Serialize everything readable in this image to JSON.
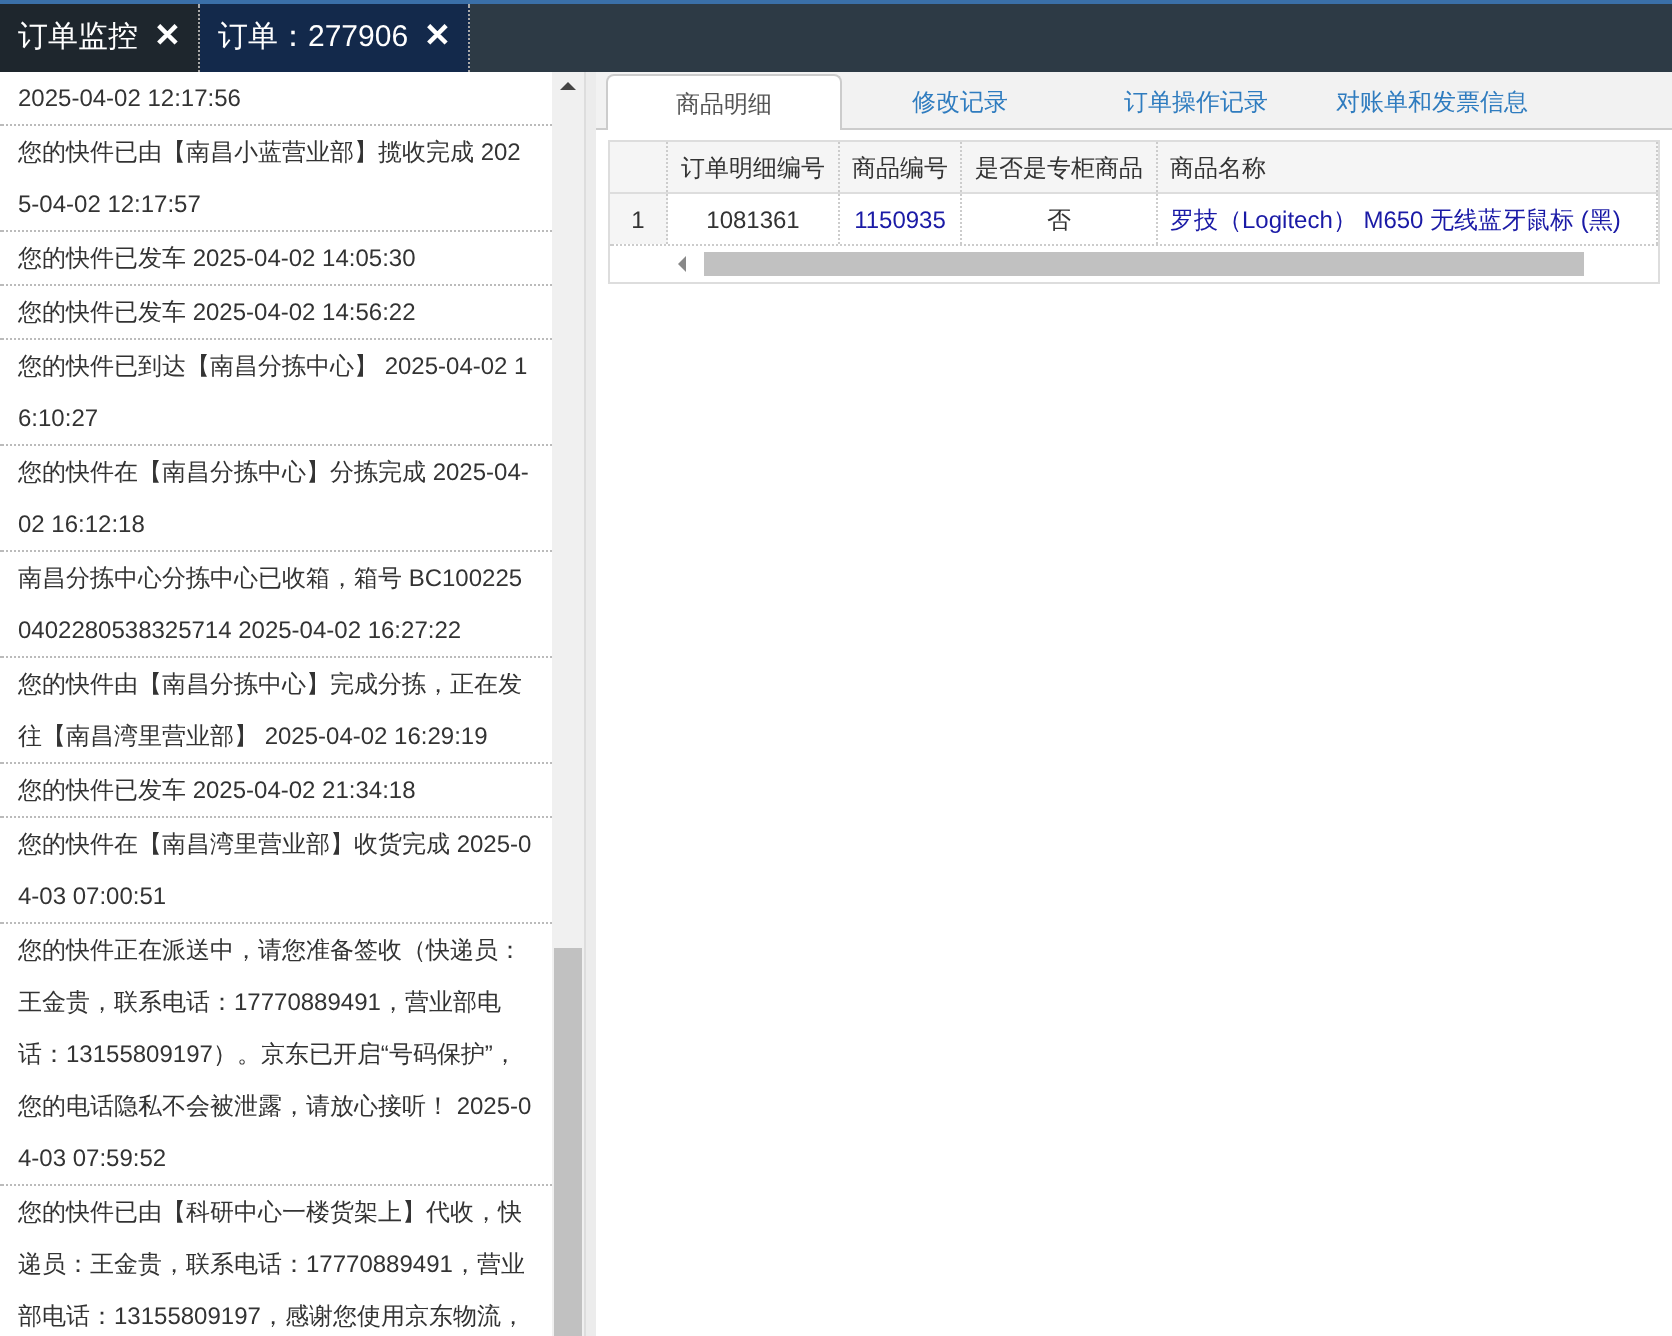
{
  "top_tabs": [
    {
      "label": "订单监控",
      "close": "✕",
      "selected": false
    },
    {
      "label": "订单：277906",
      "close": "✕",
      "selected": true
    }
  ],
  "tracking_log": [
    {
      "text": "2025-04-02 12:17:56"
    },
    {
      "text": "您的快件已由【南昌小蓝营业部】揽收完成 2025-04-02 12:17:57"
    },
    {
      "text": "您的快件已发车 2025-04-02 14:05:30"
    },
    {
      "text": "您的快件已发车 2025-04-02 14:56:22"
    },
    {
      "text": "您的快件已到达【南昌分拣中心】 2025-04-02 16:10:27"
    },
    {
      "text": "您的快件在【南昌分拣中心】分拣完成 2025-04-02 16:12:18"
    },
    {
      "text": "南昌分拣中心分拣中心已收箱，箱号 BC1002250402280538325714 2025-04-02 16:27:22"
    },
    {
      "text": "您的快件由【南昌分拣中心】完成分拣，正在发往【南昌湾里营业部】 2025-04-02 16:29:19"
    },
    {
      "text": "您的快件已发车 2025-04-02 21:34:18"
    },
    {
      "text": "您的快件在【南昌湾里营业部】收货完成 2025-04-03 07:00:51"
    },
    {
      "text": "您的快件正在派送中，请您准备签收（快递员：王金贵，联系电话：17770889491，营业部电话：13155809197）。京东已开启“号码保护”，您的电话隐私不会被泄露，请放心接听！ 2025-04-03 07:59:52"
    },
    {
      "text": "您的快件已由【科研中心一楼货架上】代收，快递员：王金贵，联系电话：17770889491，营业部电话：13155809197，感谢您使用京东物流，"
    }
  ],
  "detail_tabs": [
    {
      "label": "商品明细",
      "selected": true
    },
    {
      "label": "修改记录",
      "selected": false
    },
    {
      "label": "订单操作记录",
      "selected": false
    },
    {
      "label": "对账单和发票信息",
      "selected": false
    }
  ],
  "table": {
    "columns": [
      "订单明细编号",
      "商品编号",
      "是否是专柜商品",
      "商品名称"
    ],
    "rows": [
      {
        "index": "1",
        "cells": [
          "1081361",
          "1150935",
          "否",
          "罗技（Logitech） M650 无线蓝牙鼠标 (黑)"
        ]
      }
    ]
  }
}
